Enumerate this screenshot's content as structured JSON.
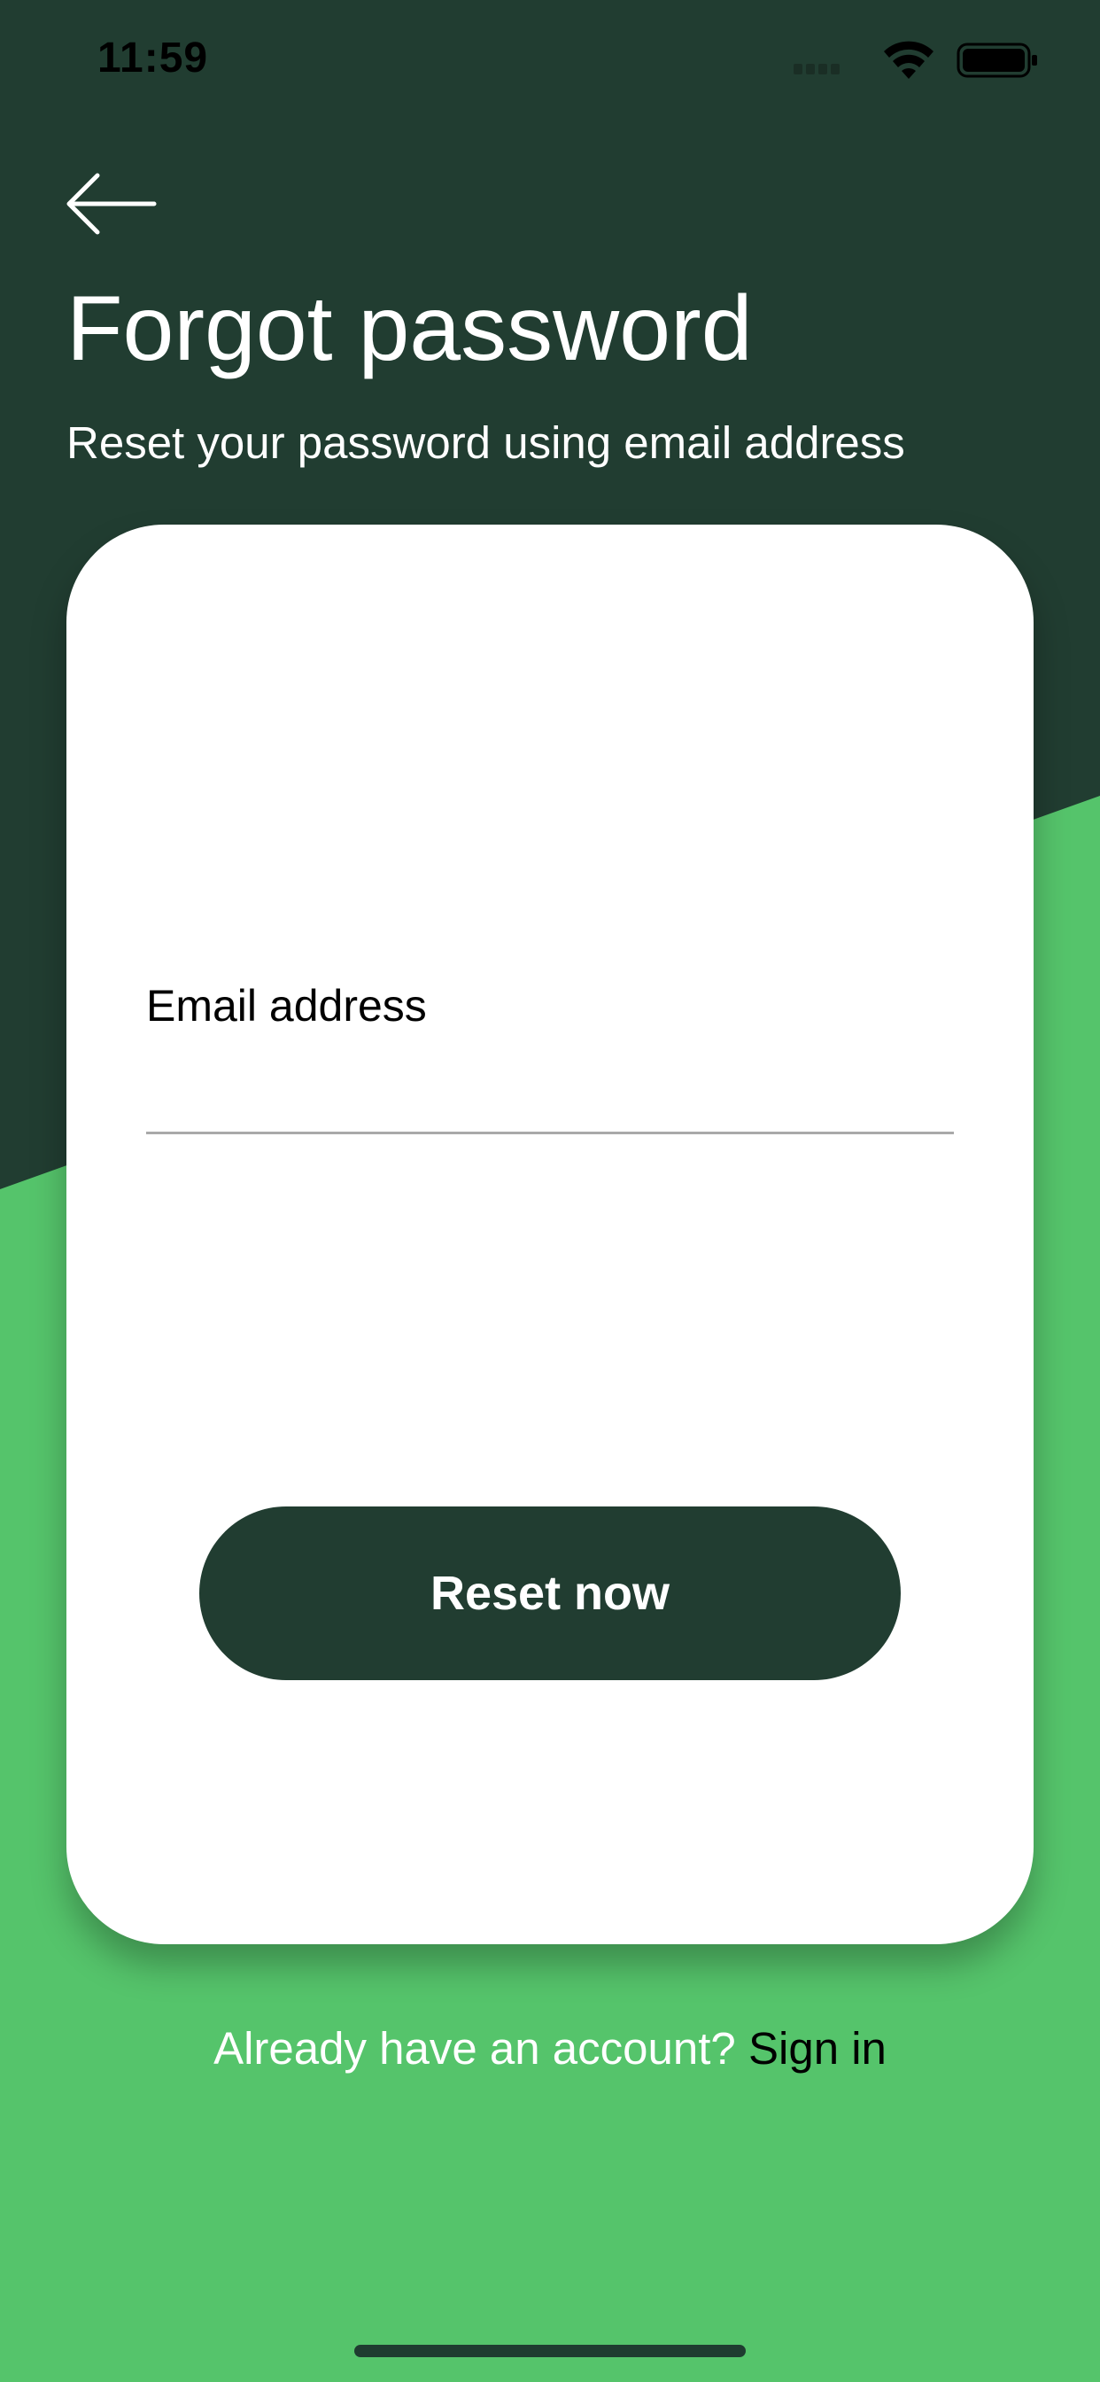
{
  "colors": {
    "dark_green": "#213d31",
    "bright_green": "#55c46b",
    "card": "#ffffff",
    "button": "#213d31",
    "input_underline": "#a9a9a9"
  },
  "status_bar": {
    "time": "11:59",
    "icons": [
      "signal-icon",
      "wifi-icon",
      "battery-icon"
    ]
  },
  "header": {
    "back_icon": "arrow-left-icon",
    "title": "Forgot password",
    "subtitle": "Reset your password using email address"
  },
  "form": {
    "email_label": "Email address",
    "email_value": "",
    "email_placeholder": "",
    "submit_label": "Reset now"
  },
  "footer": {
    "prompt": "Already have an account?",
    "link_label": "Sign in"
  }
}
